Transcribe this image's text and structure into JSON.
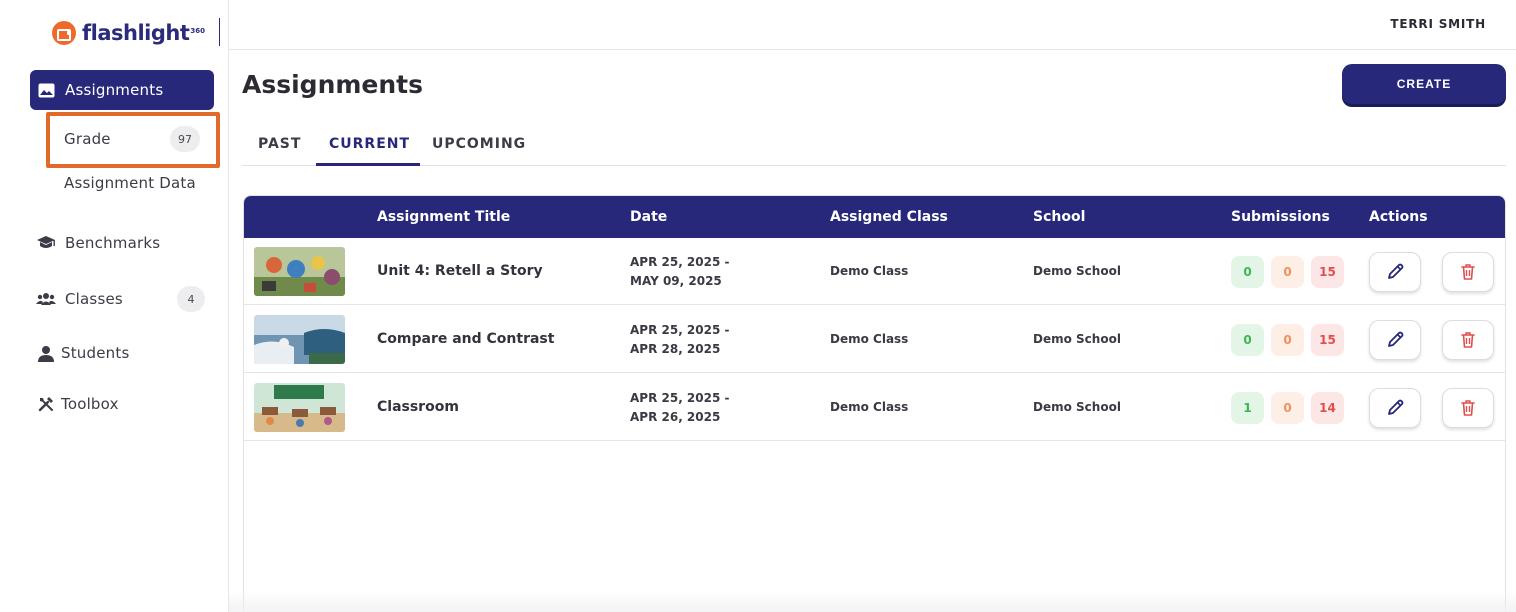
{
  "brand": {
    "name": "flashlight",
    "superscript": "360"
  },
  "header": {
    "user_name": "TERRI SMITH"
  },
  "sidebar": {
    "items": [
      {
        "label": "Assignments",
        "icon": "image-icon",
        "active": true
      },
      {
        "label": "Benchmarks",
        "icon": "graduation-cap-icon"
      },
      {
        "label": "Classes",
        "icon": "users-icon",
        "count": "4"
      },
      {
        "label": "Students",
        "icon": "user-icon"
      },
      {
        "label": "Toolbox",
        "icon": "tools-icon"
      }
    ],
    "sub_items": [
      {
        "label": "Grade",
        "count": "97"
      },
      {
        "label": "Assignment Data"
      }
    ]
  },
  "main": {
    "title": "Assignments",
    "create_label": "CREATE",
    "tabs": [
      {
        "label": "PAST"
      },
      {
        "label": "CURRENT",
        "active": true
      },
      {
        "label": "UPCOMING"
      }
    ]
  },
  "table": {
    "columns": [
      "Assignment Title",
      "Date",
      "Assigned Class",
      "School",
      "Submissions",
      "Actions"
    ],
    "rows": [
      {
        "title": "Unit 4: Retell a Story",
        "date_start": "APR 25, 2025 -",
        "date_end": "MAY 09, 2025",
        "class": "Demo Class",
        "school": "Demo School",
        "sub_green": "0",
        "sub_orange": "0",
        "sub_red": "15"
      },
      {
        "title": "Compare and Contrast",
        "date_start": "APR 25, 2025 -",
        "date_end": "APR 28, 2025",
        "class": "Demo Class",
        "school": "Demo School",
        "sub_green": "0",
        "sub_orange": "0",
        "sub_red": "15"
      },
      {
        "title": "Classroom",
        "date_start": "APR 25, 2025 -",
        "date_end": "APR 26, 2025",
        "class": "Demo Class",
        "school": "Demo School",
        "sub_green": "1",
        "sub_orange": "0",
        "sub_red": "14"
      }
    ]
  },
  "colors": {
    "brand_navy": "#27287a",
    "brand_orange": "#ef6a2a",
    "highlight": "#e06a2c",
    "sub_green": "#3fb552",
    "sub_orange": "#ef915d",
    "sub_red": "#e04f4f"
  }
}
